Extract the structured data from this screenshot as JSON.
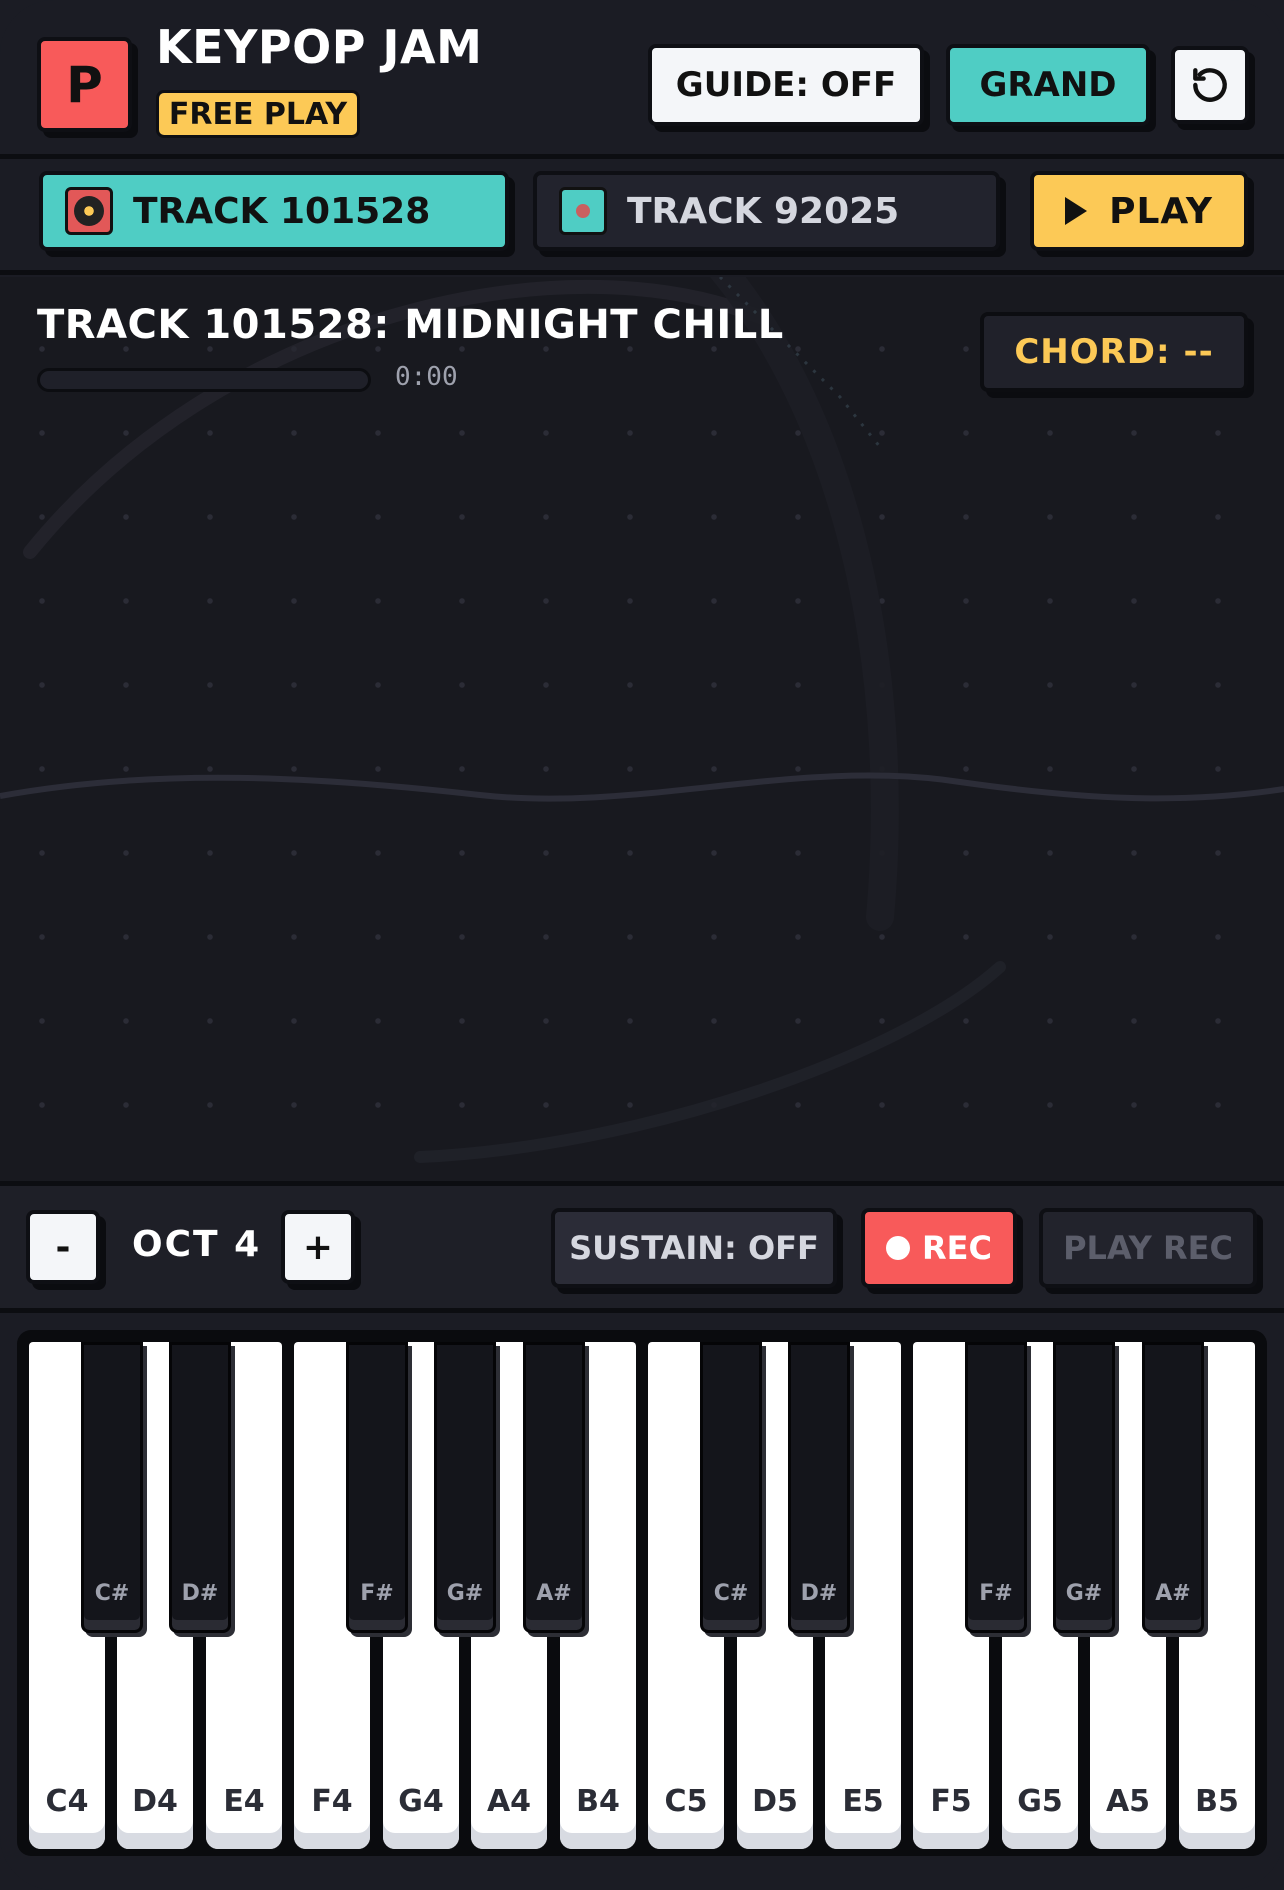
{
  "app": {
    "logo_letter": "P",
    "title": "KEYPOP JAM",
    "mode_badge": "FREE PLAY"
  },
  "toolbar": {
    "guide_label": "GUIDE: OFF",
    "instrument_label": "GRAND",
    "reset_icon": "reset-icon"
  },
  "tracks": [
    {
      "label": "TRACK 101528",
      "active": true
    },
    {
      "label": "TRACK 92025",
      "active": false
    }
  ],
  "play_label": "PLAY",
  "now_playing": {
    "title": "TRACK 101528: MIDNIGHT CHILL",
    "time": "0:00",
    "progress": 0,
    "chord": "CHORD: --"
  },
  "controls": {
    "octave_minus": "-",
    "octave_label": "OCT 4",
    "octave_plus": "+",
    "sustain_label": "SUSTAIN: OFF",
    "rec_label": "REC",
    "play_rec_label": "PLAY REC"
  },
  "keyboard": {
    "white_keys": [
      "C4",
      "D4",
      "E4",
      "F4",
      "G4",
      "A4",
      "B4",
      "C5",
      "D5",
      "E5",
      "F5",
      "G5",
      "A5",
      "B5"
    ],
    "black_keys": [
      "C#",
      "D#",
      "F#",
      "G#",
      "A#",
      "C#",
      "D#",
      "F#",
      "G#",
      "A#"
    ]
  },
  "colors": {
    "accent_teal": "#4fcdc4",
    "accent_yellow": "#fcc956",
    "accent_red": "#f85a5a",
    "background": "#1b1c24"
  }
}
